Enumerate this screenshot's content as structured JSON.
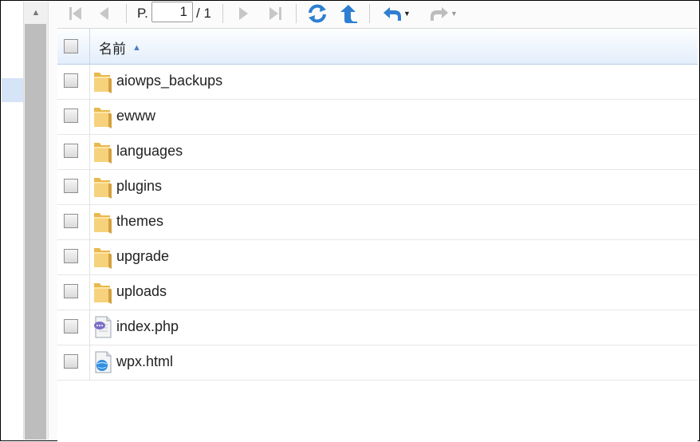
{
  "toolbar": {
    "page_label": "P.",
    "page_value": "1",
    "page_total": "/ 1",
    "buttons": [
      "first-page",
      "previous-page",
      "next-page",
      "last-page",
      "refresh",
      "up-folder",
      "back",
      "forward"
    ]
  },
  "grid": {
    "header": {
      "name_label": "名前",
      "sort": "ascending"
    },
    "rows": [
      {
        "name": "aiowps_backups",
        "type": "folder"
      },
      {
        "name": "ewww",
        "type": "folder"
      },
      {
        "name": "languages",
        "type": "folder"
      },
      {
        "name": "plugins",
        "type": "folder"
      },
      {
        "name": "themes",
        "type": "folder"
      },
      {
        "name": "upgrade",
        "type": "folder"
      },
      {
        "name": "uploads",
        "type": "folder"
      },
      {
        "name": "index.php",
        "type": "php-file"
      },
      {
        "name": "wpx.html",
        "type": "html-file"
      }
    ]
  },
  "colors": {
    "header_gradient_end": "#e3eefb",
    "sort_arrow": "#4a7fc8",
    "folder": "#f2c76b",
    "refresh_blue": "#2e7fd1"
  }
}
